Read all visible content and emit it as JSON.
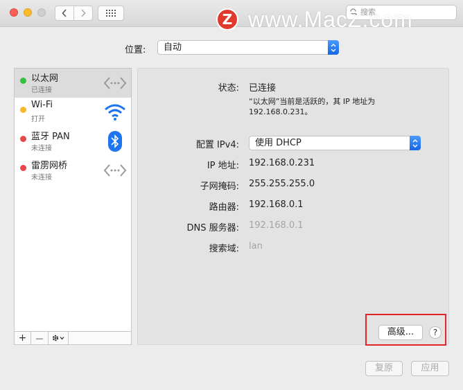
{
  "search": {
    "placeholder": "搜索"
  },
  "watermark": {
    "logo_letter": "Z",
    "text": "www.MacZ.com"
  },
  "location": {
    "label": "位置:",
    "value": "自动"
  },
  "services": [
    {
      "name": "以太网",
      "status": "已连接",
      "dot_color": "#30c23f",
      "icon": "ethernet-icon",
      "selected": true
    },
    {
      "name": "Wi-Fi",
      "status": "打开",
      "dot_color": "#f5b829",
      "icon": "wifi-icon",
      "selected": false
    },
    {
      "name": "蓝牙 PAN",
      "status": "未连接",
      "dot_color": "#e8474a",
      "icon": "bluetooth-icon",
      "selected": false
    },
    {
      "name": "雷雳网桥",
      "status": "未连接",
      "dot_color": "#e8474a",
      "icon": "thunderbolt-bridge-icon",
      "selected": false
    }
  ],
  "sidebar_controls": {
    "add": "+",
    "remove": "—"
  },
  "details": {
    "status_label": "状态:",
    "status_value": "已连接",
    "status_desc_line1": "“以太网”当前是活跃的，其 IP 地址为",
    "status_desc_line2": "192.168.0.231。",
    "ipv4_label": "配置 IPv4:",
    "ipv4_value": "使用 DHCP",
    "ip_label": "IP 地址:",
    "ip_value": "192.168.0.231",
    "subnet_label": "子网掩码:",
    "subnet_value": "255.255.255.0",
    "router_label": "路由器:",
    "router_value": "192.168.0.1",
    "dns_label": "DNS 服务器:",
    "dns_value": "192.168.0.1",
    "search_domain_label": "搜索域:",
    "search_domain_value": "lan",
    "advanced_button": "高级...",
    "help_button": "?"
  },
  "footer": {
    "revert": "复原",
    "apply": "应用"
  },
  "colors": {
    "highlight_box": "#e0242a",
    "accent": "#1f74ef"
  }
}
